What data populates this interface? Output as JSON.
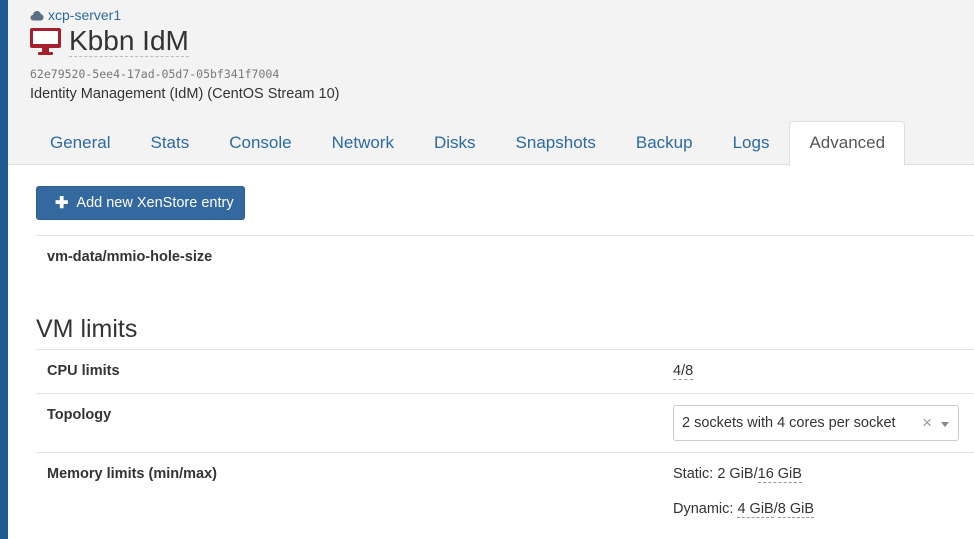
{
  "host": {
    "name": "xcp-server1",
    "icon": "cloud-icon"
  },
  "vm": {
    "title": "Kbbn IdM",
    "icon": "monitor-icon",
    "uuid": "62e79520-5ee4-17ad-05d7-05bf341f7004",
    "description": "Identity Management (IdM) (CentOS Stream 10)"
  },
  "tabs": [
    {
      "label": "General"
    },
    {
      "label": "Stats"
    },
    {
      "label": "Console"
    },
    {
      "label": "Network"
    },
    {
      "label": "Disks"
    },
    {
      "label": "Snapshots"
    },
    {
      "label": "Backup"
    },
    {
      "label": "Logs"
    },
    {
      "label": "Advanced",
      "active": true
    }
  ],
  "xenstore": {
    "add_button": "Add new XenStore entry",
    "entries": [
      {
        "key": "vm-data/mmio-hole-size"
      }
    ]
  },
  "vm_limits": {
    "title": "VM limits",
    "cpu_label": "CPU limits",
    "cpu_value": "4/8",
    "topology_label": "Topology",
    "topology_value": "2 sockets with 4 cores per socket",
    "topology_clear": "×",
    "memory_label": "Memory limits (min/max)",
    "static_label": "Static: ",
    "static_min": "2 GiB",
    "static_max": "16 GiB",
    "dynamic_label": "Dynamic: ",
    "dynamic_min": "4 GiB",
    "dynamic_max": "8 GiB"
  },
  "colors": {
    "accent": "#33699e",
    "link": "#2c6aa0",
    "vm_icon": "#a4202c",
    "sidebar": "#1f5b91"
  }
}
